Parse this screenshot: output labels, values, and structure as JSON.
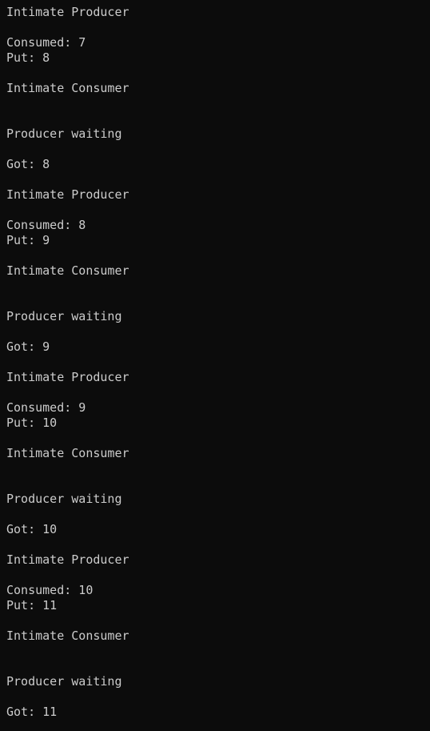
{
  "terminal": {
    "lines": [
      "Intimate Producer",
      "",
      "Consumed: 7",
      "Put: 8",
      "",
      "Intimate Consumer",
      "",
      "",
      "Producer waiting",
      "",
      "Got: 8",
      "",
      "Intimate Producer",
      "",
      "Consumed: 8",
      "Put: 9",
      "",
      "Intimate Consumer",
      "",
      "",
      "Producer waiting",
      "",
      "Got: 9",
      "",
      "Intimate Producer",
      "",
      "Consumed: 9",
      "Put: 10",
      "",
      "Intimate Consumer",
      "",
      "",
      "Producer waiting",
      "",
      "Got: 10",
      "",
      "Intimate Producer",
      "",
      "Consumed: 10",
      "Put: 11",
      "",
      "Intimate Consumer",
      "",
      "",
      "Producer waiting",
      "",
      "Got: 11"
    ]
  }
}
